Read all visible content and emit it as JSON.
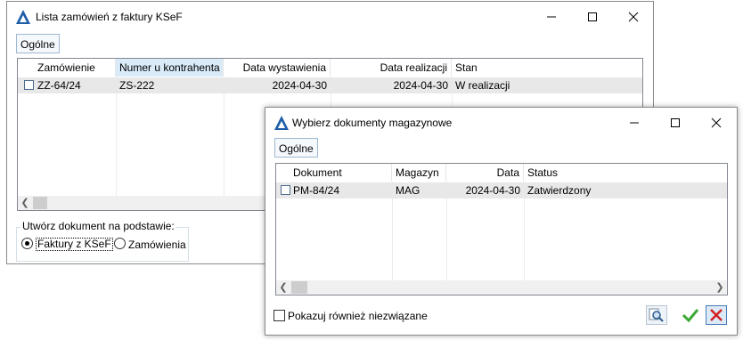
{
  "window1": {
    "title": "Lista zamówień z faktury KSeF",
    "tab": "Ogólne",
    "columns": [
      "Zamówienie",
      "Numer u kontrahenta",
      "Data wystawienia",
      "Data realizacji",
      "Stan"
    ],
    "rows": [
      {
        "order": "ZZ-64/24",
        "contractor_no": "ZS-222",
        "issue_date": "2024-04-30",
        "realization_date": "2024-04-30",
        "status": "W realizacji"
      }
    ],
    "group_title": "Utwórz dokument na podstawie:",
    "radio_options": [
      "Faktury z KSeF",
      "Zamówienia"
    ],
    "selected_option": "Faktury z KSeF"
  },
  "window2": {
    "title": "Wybierz dokumenty magazynowe",
    "tab": "Ogólne",
    "columns": [
      "Dokument",
      "Magazyn",
      "Data",
      "Status"
    ],
    "rows": [
      {
        "document": "PM-84/24",
        "warehouse": "MAG",
        "date": "2024-04-30",
        "status": "Zatwierdzony"
      }
    ],
    "checkbox_label": "Pokazuj również niezwiązane"
  },
  "icons": {
    "logo": "comarch-logo-icon",
    "minimize": "minimize-icon",
    "maximize": "maximize-icon",
    "close": "close-icon",
    "search": "search-icon",
    "confirm": "check-icon",
    "cancel": "cancel-x-icon"
  },
  "colors": {
    "logo_blue": "#1e5fa8",
    "header_highlight": "#d9ebf9",
    "selected_row": "#e8e8e8",
    "confirm_green": "#3aa935",
    "cancel_red": "#d22020"
  }
}
